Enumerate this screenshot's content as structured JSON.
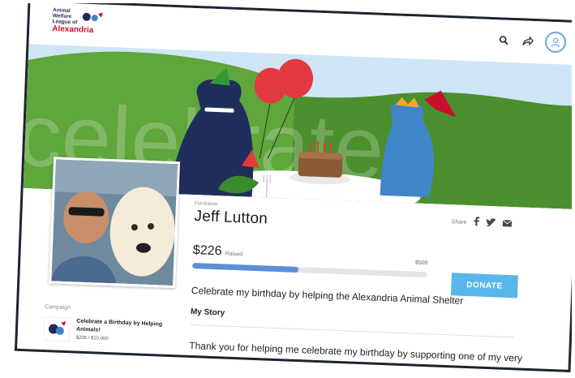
{
  "logo": {
    "line1": "Animal",
    "line2": "Welfare",
    "line3": "League",
    "line4": "of",
    "line5": "Alexandria"
  },
  "header": {
    "icons": [
      "search-icon",
      "share-arrow-icon",
      "user-avatar-icon"
    ]
  },
  "banner": {
    "watermark": "celebrate",
    "colors": {
      "sky": "#cfe6f6",
      "hill": "#5fa63b",
      "hill_dark": "#4b8f2e",
      "dog": "#1f2e5a",
      "cat": "#3f86c8",
      "balloon": "#e23a3f",
      "cake": "#8a5a34"
    }
  },
  "fundraiser": {
    "eyebrow": "Fundraiser",
    "name": "Jeff Lutton",
    "share_label": "Share",
    "share_icons": [
      "facebook-icon",
      "twitter-icon",
      "email-icon"
    ],
    "amount": "$226",
    "raised_label": "Raised",
    "goal": "$500",
    "progress": 0.452,
    "donate_label": "DONATE",
    "headline": "Celebrate my birthday by helping the Alexandria Animal Shelter",
    "story_heading": "My Story",
    "story_text": "Thank you for helping me celebrate my birthday by supporting one of my very favorite non-profits - the Animal Welfare League of Alexandria"
  },
  "campaign": {
    "caption": "Campaign",
    "title": "Celebrate a Birthday by Helping Animals!",
    "amounts": "$226 / $10,000"
  },
  "accent": "#59b6ea"
}
